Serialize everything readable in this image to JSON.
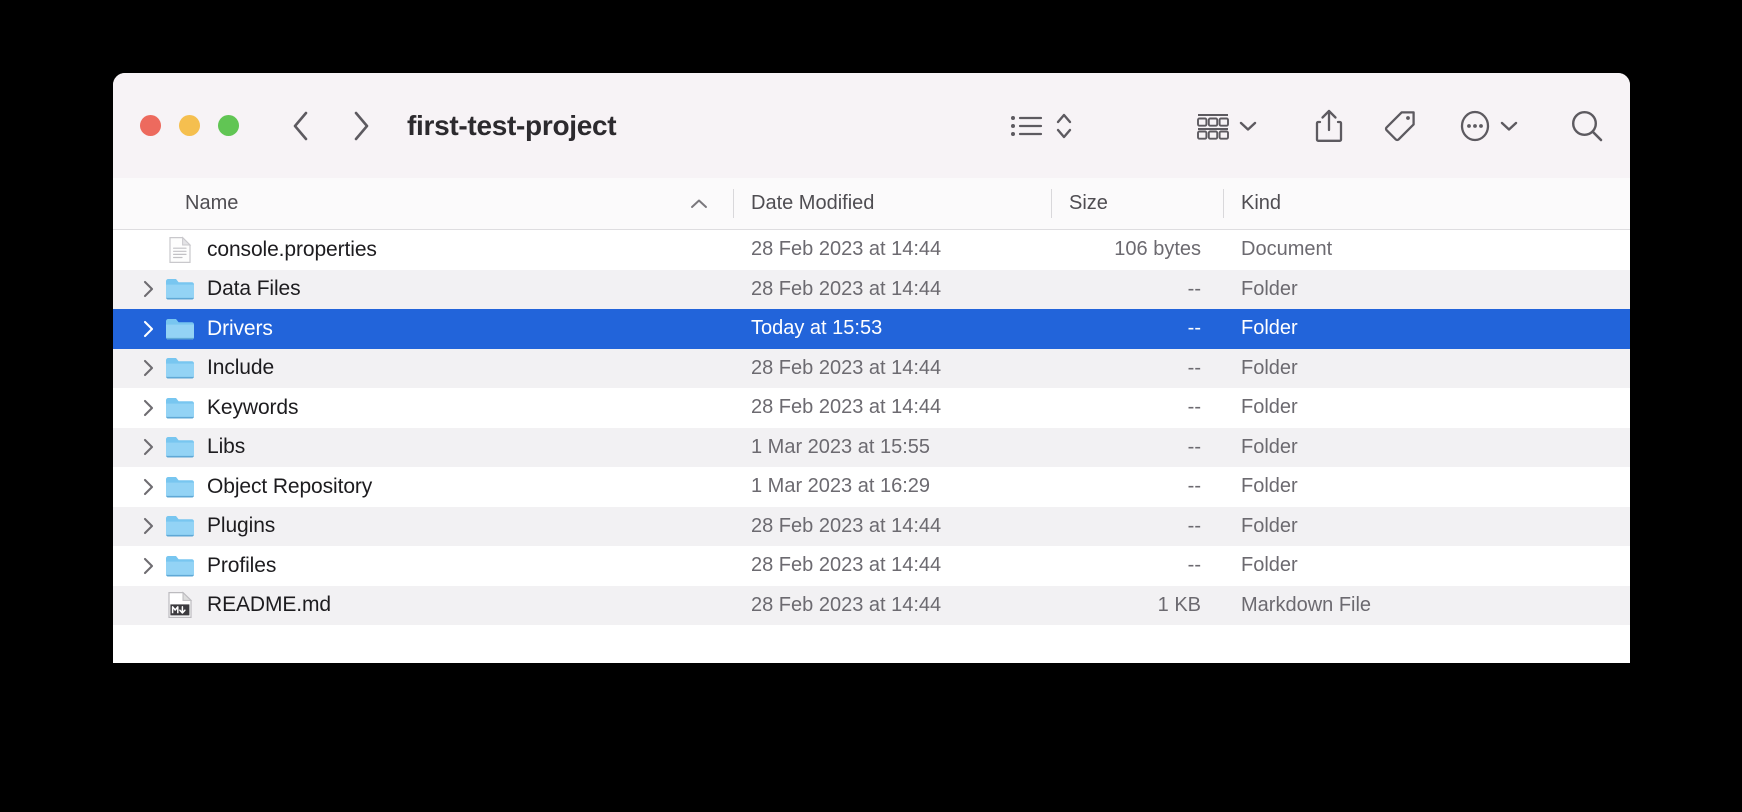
{
  "window": {
    "title": "first-test-project",
    "traffic_lights": [
      {
        "name": "close",
        "color": "#ed6a5e"
      },
      {
        "name": "minimize",
        "color": "#f5bf4f"
      },
      {
        "name": "maximize",
        "color": "#61c554"
      }
    ],
    "accent_selection_color": "#2264da"
  },
  "toolbar": {
    "back_icon": "chevron-left-icon",
    "forward_icon": "chevron-right-icon",
    "view_list_icon": "list-view-icon",
    "view_sort_icon": "sort-updown-icon",
    "group_icon": "group-items-icon",
    "group_chevron_icon": "chevron-down-icon",
    "share_icon": "share-icon",
    "tag_icon": "tag-icon",
    "more_icon": "more-ellipsis-icon",
    "more_chevron_icon": "chevron-down-icon",
    "search_icon": "search-icon"
  },
  "columns": [
    {
      "key": "name",
      "label": "Name",
      "sorted": true,
      "sort_direction": "ascending",
      "sort_icon": "chevron-up-icon"
    },
    {
      "key": "date",
      "label": "Date Modified",
      "sorted": false
    },
    {
      "key": "size",
      "label": "Size",
      "sorted": false
    },
    {
      "key": "kind",
      "label": "Kind",
      "sorted": false
    }
  ],
  "files": [
    {
      "name": "console.properties",
      "date": "28 Feb 2023 at 14:44",
      "size": "106 bytes",
      "kind": "Document",
      "icon": "document-icon",
      "expandable": false,
      "selected": false
    },
    {
      "name": "Data Files",
      "date": "28 Feb 2023 at 14:44",
      "size": "--",
      "kind": "Folder",
      "icon": "folder-icon",
      "expandable": true,
      "selected": false
    },
    {
      "name": "Drivers",
      "date": "Today at 15:53",
      "size": "--",
      "kind": "Folder",
      "icon": "folder-icon",
      "expandable": true,
      "selected": true
    },
    {
      "name": "Include",
      "date": "28 Feb 2023 at 14:44",
      "size": "--",
      "kind": "Folder",
      "icon": "folder-icon",
      "expandable": true,
      "selected": false
    },
    {
      "name": "Keywords",
      "date": "28 Feb 2023 at 14:44",
      "size": "--",
      "kind": "Folder",
      "icon": "folder-icon",
      "expandable": true,
      "selected": false
    },
    {
      "name": "Libs",
      "date": "1 Mar 2023 at 15:55",
      "size": "--",
      "kind": "Folder",
      "icon": "folder-icon",
      "expandable": true,
      "selected": false
    },
    {
      "name": "Object Repository",
      "date": "1 Mar 2023 at 16:29",
      "size": "--",
      "kind": "Folder",
      "icon": "folder-icon",
      "expandable": true,
      "selected": false
    },
    {
      "name": "Plugins",
      "date": "28 Feb 2023 at 14:44",
      "size": "--",
      "kind": "Folder",
      "icon": "folder-icon",
      "expandable": true,
      "selected": false
    },
    {
      "name": "Profiles",
      "date": "28 Feb 2023 at 14:44",
      "size": "--",
      "kind": "Folder",
      "icon": "folder-icon",
      "expandable": true,
      "selected": false
    },
    {
      "name": "README.md",
      "date": "28 Feb 2023 at 14:44",
      "size": "1 KB",
      "kind": "Markdown File",
      "icon": "markdown-icon",
      "expandable": false,
      "selected": false
    }
  ]
}
